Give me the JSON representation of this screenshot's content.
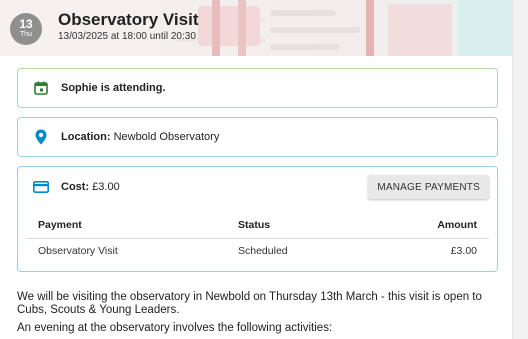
{
  "event": {
    "day": "13",
    "weekday": "Thu",
    "title": "Observatory Visit",
    "time": "13/03/2025 at 18:00 until 20:30"
  },
  "attendance": {
    "text": "Sophie is attending.",
    "icon": "calendar-check-icon",
    "color": "#2e7d32"
  },
  "location": {
    "label": "Location:",
    "value": "Newbold Observatory",
    "icon": "map-pin-icon",
    "color": "#0288d1"
  },
  "cost": {
    "label": "Cost:",
    "value": "£3.00",
    "icon": "credit-card-icon",
    "color": "#0288d1",
    "manage_button": "MANAGE PAYMENTS",
    "table": {
      "headers": [
        "Payment",
        "Status",
        "Amount"
      ],
      "rows": [
        [
          "Observatory Visit",
          "Scheduled",
          "£3.00"
        ]
      ]
    }
  },
  "description": {
    "para1": "We will be visiting the observatory in Newbold on Thursday 13th March - this visit is open to Cubs, Scouts & Young Leaders.",
    "para2": "An evening at the observatory involves the following activities:"
  }
}
